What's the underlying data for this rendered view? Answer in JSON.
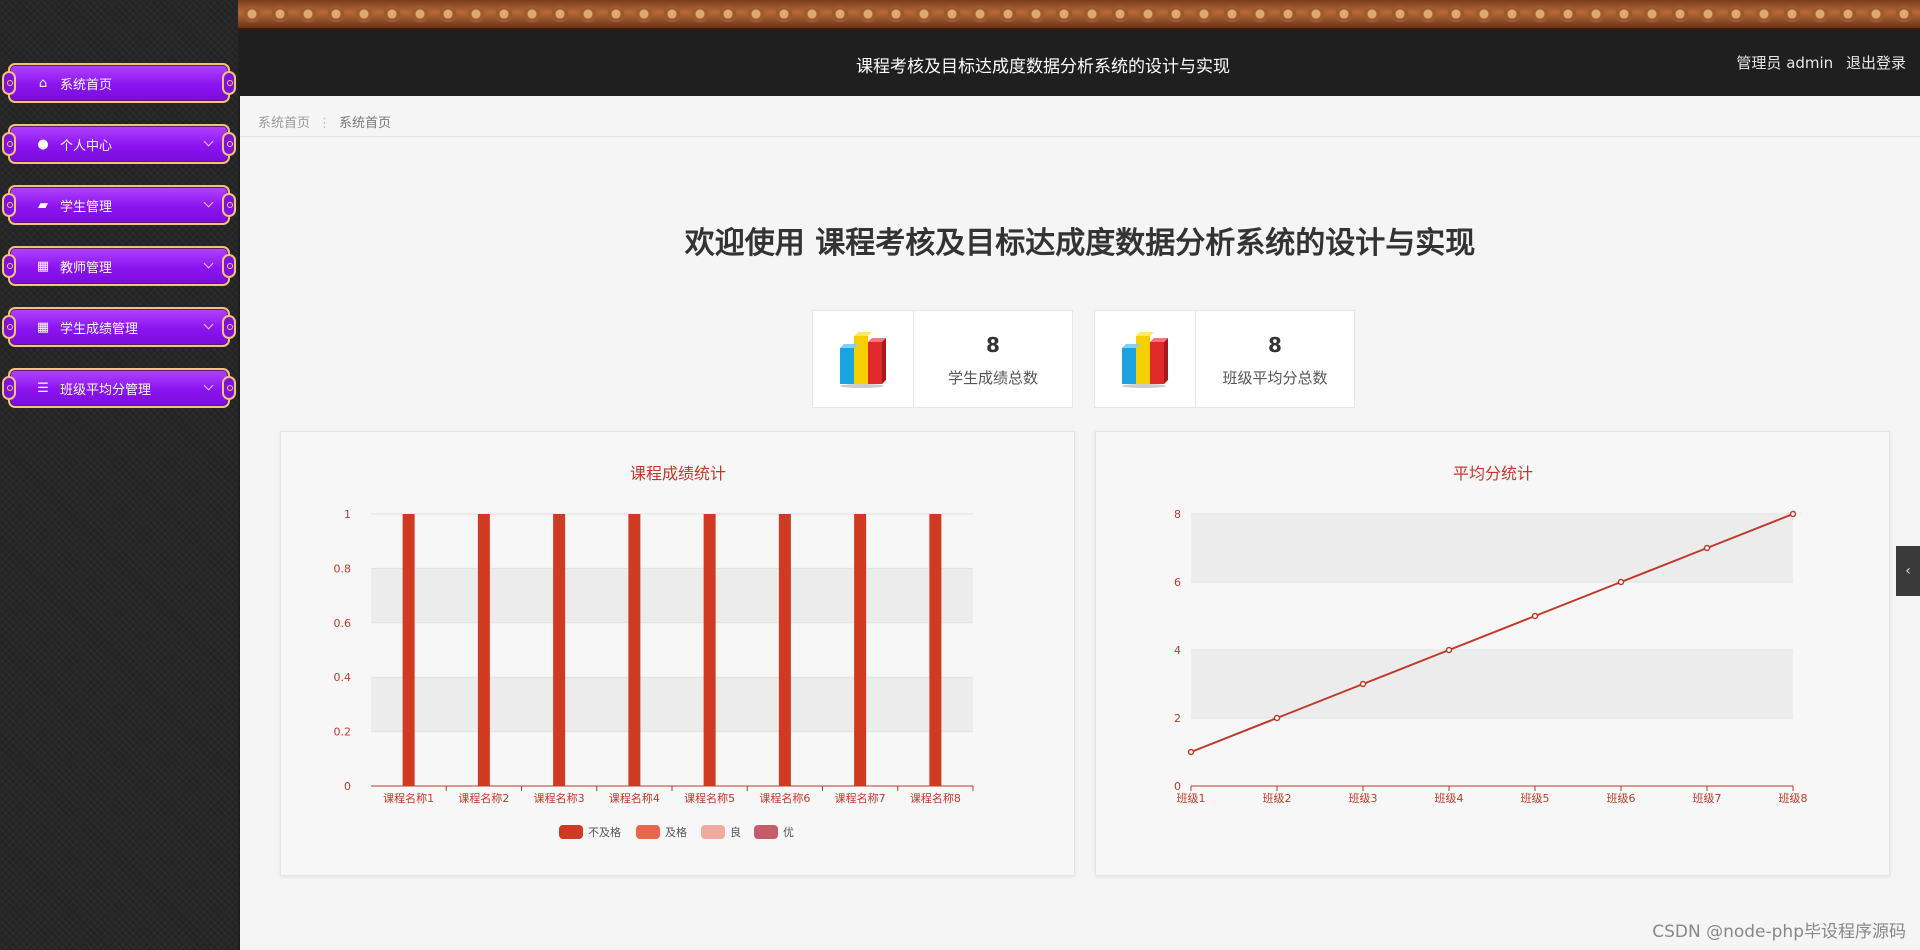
{
  "header": {
    "title": "课程考核及目标达成度数据分析系统的设计与实现",
    "user_label": "管理员 admin",
    "logout_label": "退出登录"
  },
  "sidebar": {
    "items": [
      {
        "label": "系统首页",
        "icon": "home-icon",
        "expandable": false
      },
      {
        "label": "个人中心",
        "icon": "user-icon",
        "expandable": true
      },
      {
        "label": "学生管理",
        "icon": "briefcase-icon",
        "expandable": true
      },
      {
        "label": "教师管理",
        "icon": "grid-icon",
        "expandable": true
      },
      {
        "label": "学生成绩管理",
        "icon": "grid-icon",
        "expandable": true
      },
      {
        "label": "班级平均分管理",
        "icon": "list-icon",
        "expandable": true
      }
    ]
  },
  "breadcrumb": {
    "root": "系统首页",
    "sep": "⋮",
    "current": "系统首页"
  },
  "welcome": "欢迎使用 课程考核及目标达成度数据分析系统的设计与实现",
  "stats": [
    {
      "value": "8",
      "label": "学生成绩总数",
      "icon": "bar-chart-icon"
    },
    {
      "value": "8",
      "label": "班级平均分总数",
      "icon": "bar-chart-icon"
    }
  ],
  "watermark": "CSDN @node-php毕设程序源码",
  "colors": {
    "bar": "#d13a22",
    "line": "#c9422e",
    "accent_purple": "#8b14ef",
    "gold_border": "#f2c27b"
  },
  "chart_data": [
    {
      "type": "bar",
      "title": "课程成绩统计",
      "categories": [
        "课程名称1",
        "课程名称2",
        "课程名称3",
        "课程名称4",
        "课程名称5",
        "课程名称6",
        "课程名称7",
        "课程名称8"
      ],
      "series": [
        {
          "name": "不及格",
          "color": "#d13a22",
          "values": [
            1,
            1,
            1,
            1,
            1,
            1,
            1,
            1
          ]
        },
        {
          "name": "及格",
          "color": "#e8674c",
          "values": [
            0,
            0,
            0,
            0,
            0,
            0,
            0,
            0
          ]
        },
        {
          "name": "良",
          "color": "#f2aaa0",
          "values": [
            0,
            0,
            0,
            0,
            0,
            0,
            0,
            0
          ]
        },
        {
          "name": "优",
          "color": "#c65c6a",
          "values": [
            0,
            0,
            0,
            0,
            0,
            0,
            0,
            0
          ]
        }
      ],
      "yticks": [
        "0",
        "0.2",
        "0.4",
        "0.6",
        "0.8",
        "1"
      ],
      "ylim": [
        0,
        1
      ],
      "legend": "bottom-center",
      "grid": "alternating bands"
    },
    {
      "type": "line",
      "title": "平均分统计",
      "categories": [
        "班级1",
        "班级2",
        "班级3",
        "班级4",
        "班级5",
        "班级6",
        "班级7",
        "班级8"
      ],
      "series": [
        {
          "values": [
            1,
            2,
            3,
            4,
            5,
            6,
            7,
            8
          ]
        }
      ],
      "yticks": [
        "0",
        "2",
        "4",
        "6",
        "8"
      ],
      "ylim": [
        0,
        8
      ],
      "grid": "alternating bands"
    }
  ]
}
